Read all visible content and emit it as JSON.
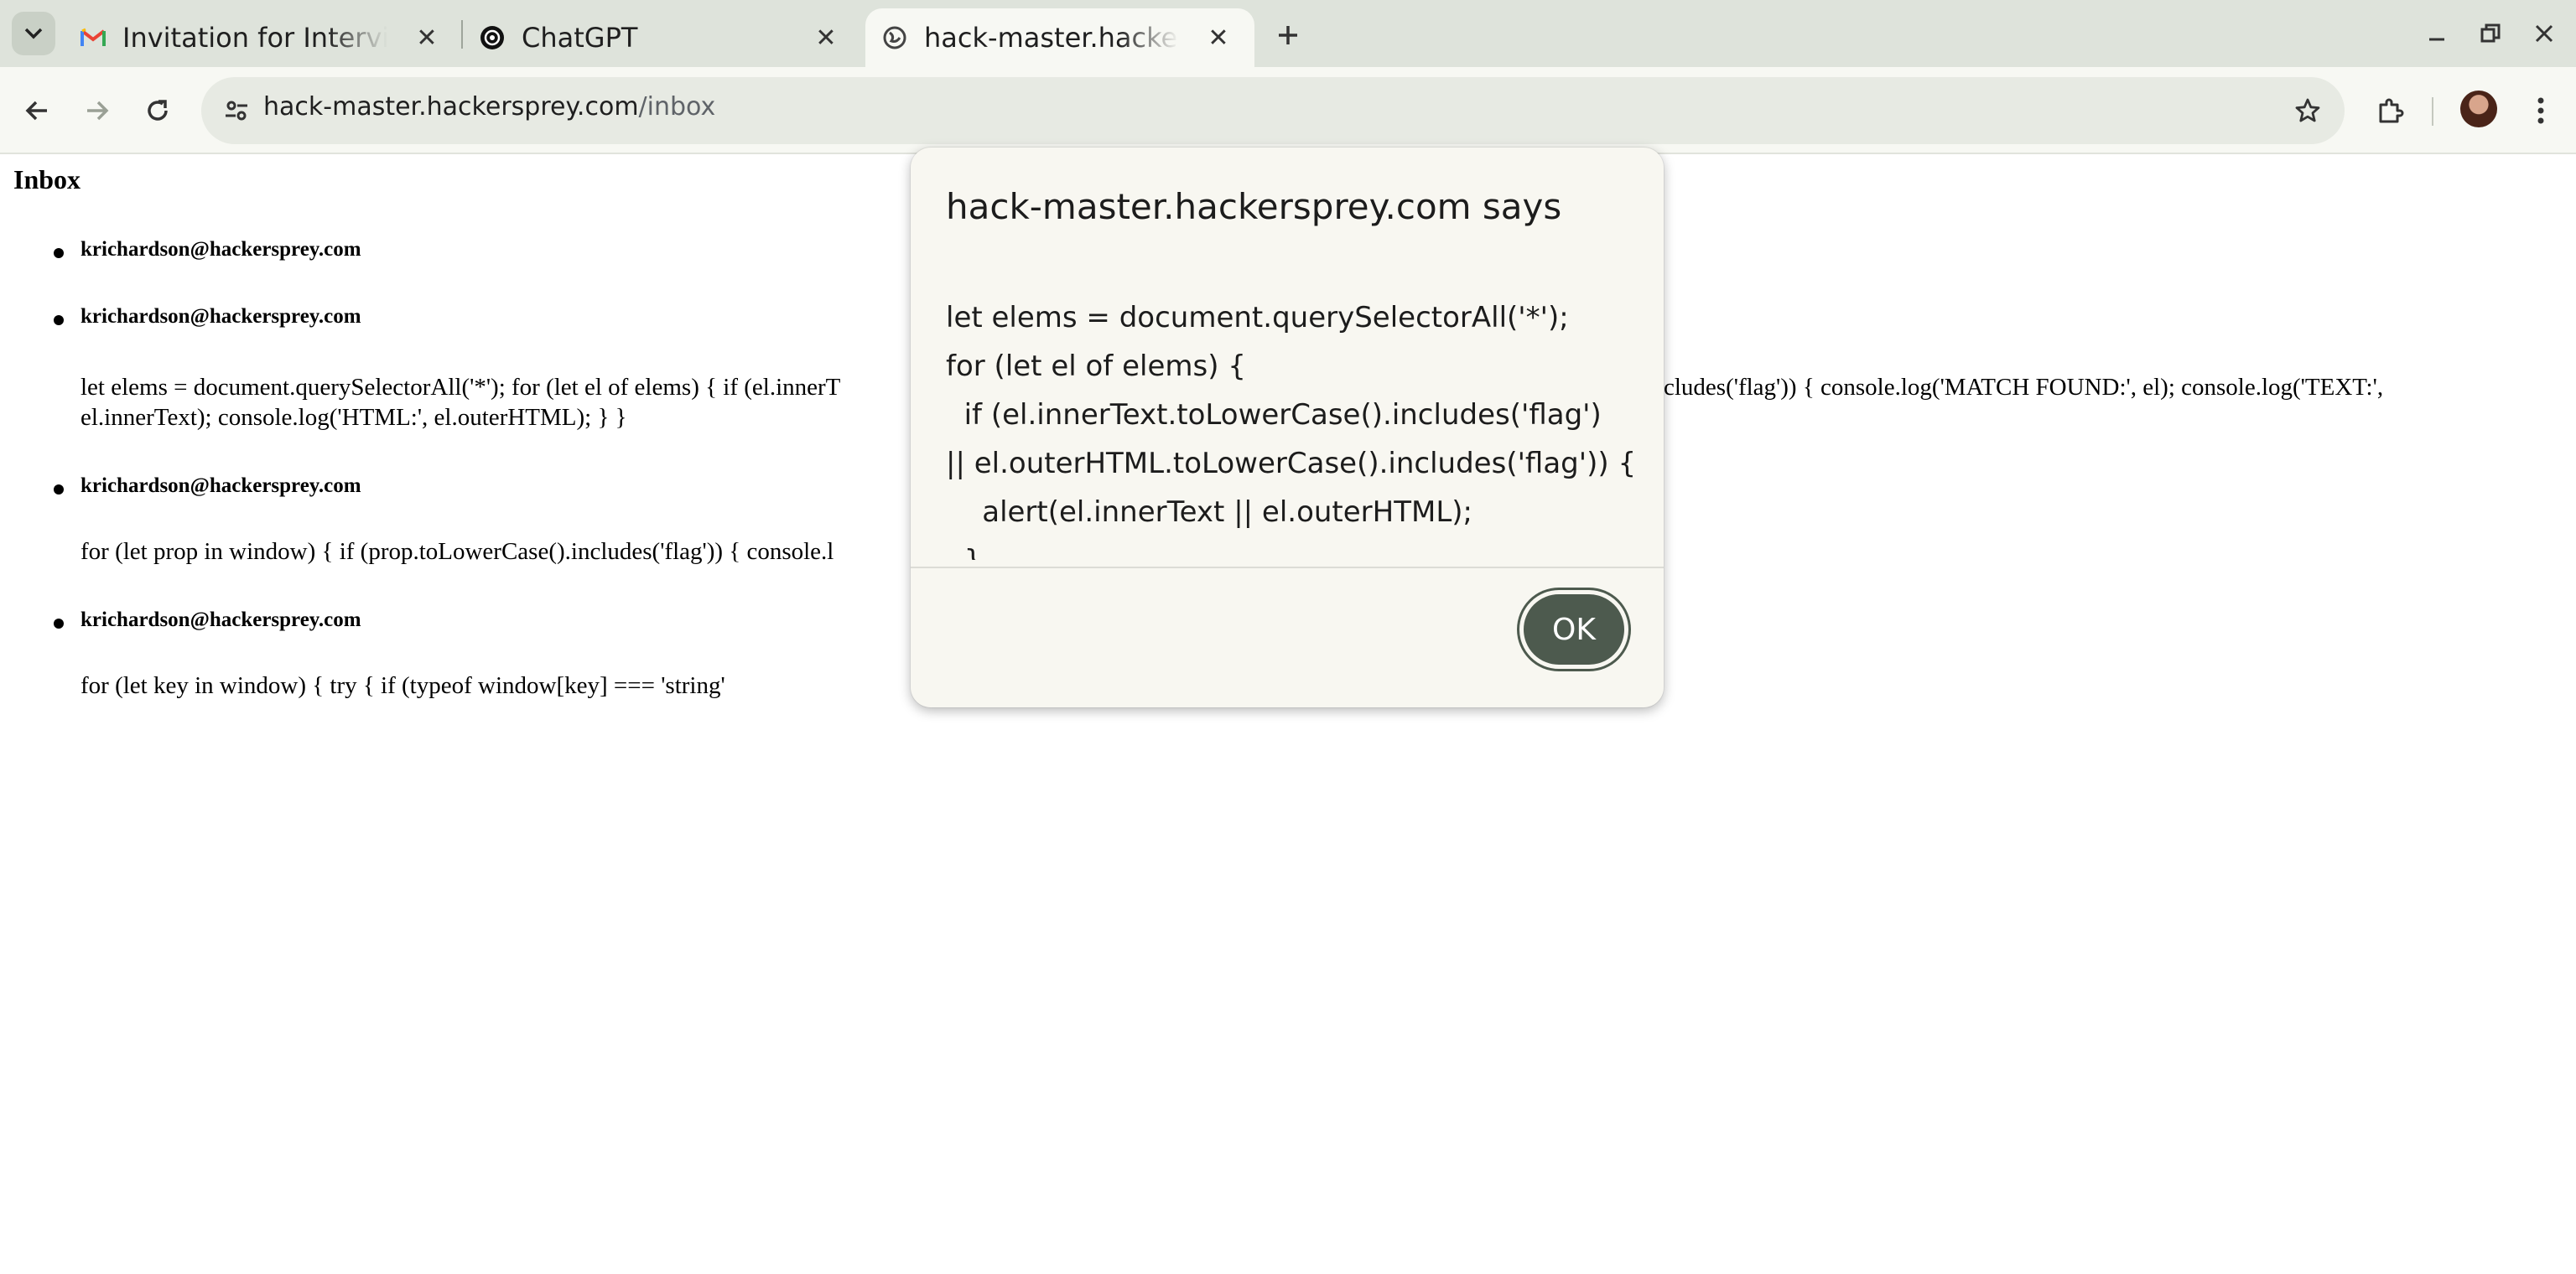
{
  "tabs": [
    {
      "title": "Invitation for Intervi",
      "favicon": "gmail-icon",
      "active": false
    },
    {
      "title": "ChatGPT",
      "favicon": "chatgpt-icon",
      "active": false
    },
    {
      "title": "hack-master.hackers",
      "favicon": "globe-icon",
      "active": true
    }
  ],
  "toolbar": {
    "url_host": "hack-master.hackersprey.com",
    "url_path": "/inbox"
  },
  "page": {
    "title": "Inbox",
    "messages": [
      {
        "sender": "krichardson@hackersprey.com",
        "body": ""
      },
      {
        "sender": "krichardson@hackersprey.com",
        "body_left": "let elems = document.querySelectorAll('*'); for (let el of elems) { if (el.innerT",
        "body_right": "cludes('flag')) { console.log('MATCH FOUND:', el); console.log('TEXT:',",
        "body_line2": "el.innerText); console.log('HTML:', el.outerHTML); } }"
      },
      {
        "sender": "krichardson@hackersprey.com",
        "body": "for (let prop in window) { if (prop.toLowerCase().includes('flag')) { console.l"
      },
      {
        "sender": "krichardson@hackersprey.com",
        "body": "for (let key in window) { try { if (typeof window[key] === 'string'"
      }
    ]
  },
  "dialog": {
    "title": "hack-master.hackersprey.com says",
    "lines": [
      "let elems = document.querySelectorAll('*');",
      "for (let el of elems) {",
      "  if (el.innerText.toLowerCase().includes('flag')",
      "|| el.outerHTML.toLowerCase().includes('flag')) {",
      "    alert(el.innerText || el.outerHTML);",
      "  }"
    ],
    "ok_label": "OK"
  },
  "colors": {
    "tabstrip": "#dee3db",
    "toolbar": "#f7f8f3",
    "ok_button": "#4d5a4e"
  }
}
